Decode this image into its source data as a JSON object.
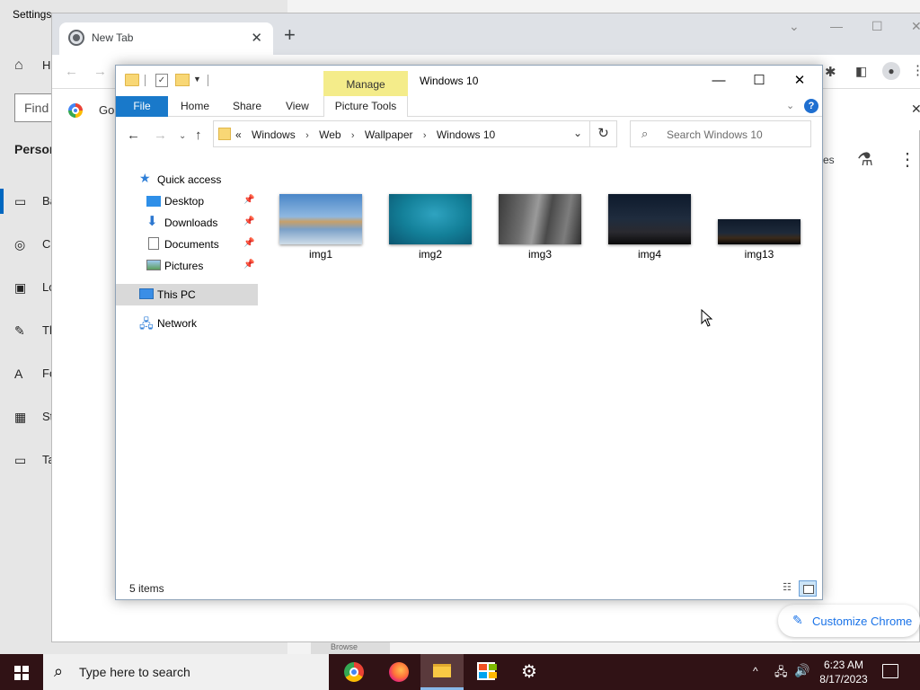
{
  "settings": {
    "title": "Settings",
    "find_placeholder": "Find",
    "section_label": "Person",
    "items": [
      {
        "label": "Ba",
        "icon": "image-icon"
      },
      {
        "label": "C",
        "icon": "palette-icon"
      },
      {
        "label": "Lo",
        "icon": "lock-screen-icon"
      },
      {
        "label": "Th",
        "icon": "themes-icon"
      },
      {
        "label": "Fo",
        "icon": "fonts-icon"
      },
      {
        "label": "St",
        "icon": "start-icon"
      },
      {
        "label": "Ta",
        "icon": "taskbar-icon"
      }
    ],
    "home_label": "H"
  },
  "chrome": {
    "tab_title": "New Tab",
    "bookmark_label": "Go",
    "right_text": "es",
    "customize_label": "Customize Chrome",
    "browse_label": "Browse"
  },
  "explorer": {
    "title": "Windows 10",
    "manage_tab": "Manage",
    "picture_tools_tab": "Picture Tools",
    "ribbon_tabs": [
      "File",
      "Home",
      "Share",
      "View"
    ],
    "breadcrumb": {
      "overflow": "«",
      "parts": [
        "Windows",
        "Web",
        "Wallpaper",
        "Windows 10"
      ]
    },
    "search_placeholder": "Search Windows 10",
    "nav": {
      "quick_access": "Quick access",
      "pinned": [
        "Desktop",
        "Downloads",
        "Documents",
        "Pictures"
      ],
      "this_pc": "This PC",
      "network": "Network"
    },
    "files": [
      {
        "name": "img1"
      },
      {
        "name": "img2"
      },
      {
        "name": "img3"
      },
      {
        "name": "img4"
      },
      {
        "name": "img13"
      }
    ],
    "status": "5 items"
  },
  "taskbar": {
    "search_placeholder": "Type here to search",
    "apps": [
      "chrome-icon",
      "firefox-icon",
      "file-explorer-icon",
      "store-icon",
      "settings-icon"
    ],
    "time": "6:23 AM",
    "date": "8/17/2023"
  },
  "colors": {
    "taskbar_bg": "#301215",
    "ribbon_file_tab": "#1979ca",
    "manage_tab": "#f4ec8a"
  }
}
